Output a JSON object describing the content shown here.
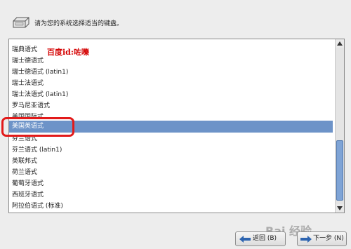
{
  "header": {
    "prompt": "请为您的系统选择适当的键盘。"
  },
  "keyboard_list": {
    "items": [
      {
        "label": "瑞典语式"
      },
      {
        "label": "瑞士德语式"
      },
      {
        "label": "瑞士德语式 (latin1)"
      },
      {
        "label": "瑞士法语式"
      },
      {
        "label": "瑞士法语式 (latin1)"
      },
      {
        "label": "罗马尼亚语式"
      },
      {
        "label": "美国国际式"
      },
      {
        "label": "美国英语式",
        "selected": true
      },
      {
        "label": "芬兰语式"
      },
      {
        "label": "芬兰语式 (latin1)"
      },
      {
        "label": "英联邦式"
      },
      {
        "label": "荷兰语式"
      },
      {
        "label": "葡萄牙语式"
      },
      {
        "label": "西班牙语式"
      },
      {
        "label": "阿拉伯语式 (标准)"
      }
    ],
    "scroll_position": 0.78
  },
  "annotations": {
    "top_watermark": "百度id:咗嚛",
    "bottom_watermark": "Bai 经验"
  },
  "buttons": {
    "back": "返回 (B)",
    "next": "下一步 (N)"
  },
  "colors": {
    "selection": "#6d93c8",
    "highlight_outline": "#e21a1a",
    "watermark_red": "#d40000"
  }
}
